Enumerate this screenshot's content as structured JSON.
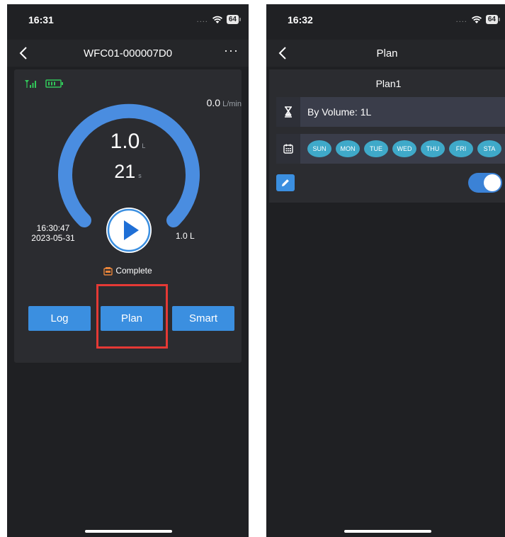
{
  "colors": {
    "accent": "#3b8fe0",
    "background": "#1f2023",
    "card": "#2b2c30",
    "highlight": "#e53935",
    "signal": "#32c85a",
    "day_chip": "#3fa9c9"
  },
  "left": {
    "status_bar": {
      "time": "16:31",
      "dots": "....",
      "battery": "64"
    },
    "nav": {
      "title": "WFC01-000007D0",
      "more": "···"
    },
    "device": {
      "flow_rate_value": "0.0",
      "flow_rate_unit": "L/min",
      "volume_value": "1.0",
      "volume_unit": "L",
      "duration_value": "21",
      "duration_unit": "s",
      "last_time": "16:30:47",
      "last_date": "2023-05-31",
      "end_volume": "1.0 L",
      "gauge_progress": 1.0,
      "status_text": "Complete"
    },
    "buttons": {
      "log": "Log",
      "plan": "Plan",
      "smart": "Smart"
    }
  },
  "right": {
    "status_bar": {
      "time": "16:32",
      "dots": "....",
      "battery": "64"
    },
    "nav": {
      "title": "Plan"
    },
    "plan": {
      "name": "Plan1",
      "volume_text": "By Volume: 1L",
      "days": [
        "SUN",
        "MON",
        "TUE",
        "WED",
        "THU",
        "FRI",
        "STA"
      ],
      "enabled": true
    }
  }
}
